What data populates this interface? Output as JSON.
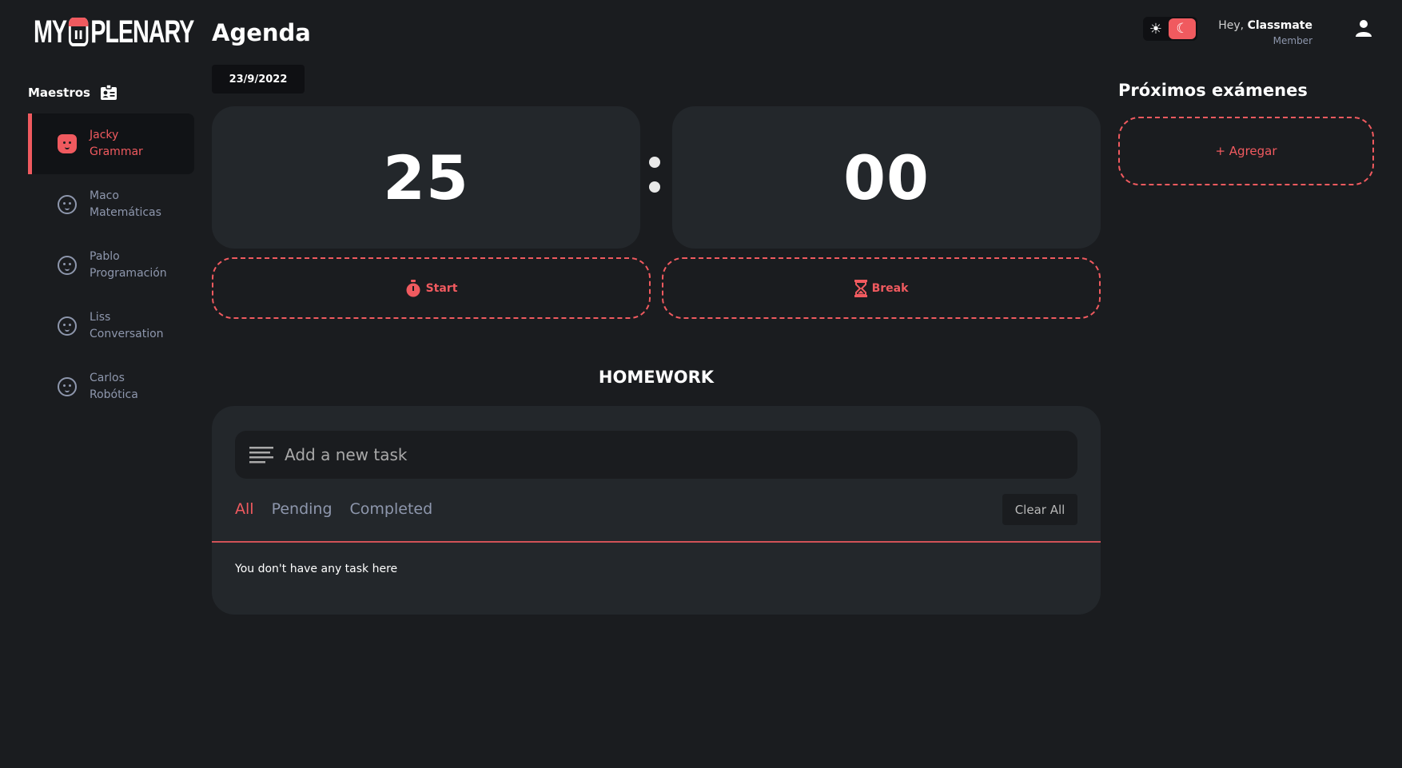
{
  "app": {
    "logo_text_left": "MY",
    "logo_text_right": "PLENARY"
  },
  "sidebar": {
    "title": "Maestros",
    "teachers": [
      {
        "name": "Jacky",
        "subject": "Grammar",
        "active": true
      },
      {
        "name": "Maco",
        "subject": "Matemáticas",
        "active": false
      },
      {
        "name": "Pablo",
        "subject": "Programación",
        "active": false
      },
      {
        "name": "Liss",
        "subject": "Conversation",
        "active": false
      },
      {
        "name": "Carlos",
        "subject": "Robótica",
        "active": false
      }
    ]
  },
  "header": {
    "page_title": "Agenda",
    "date": "23/9/2022",
    "greeting": "Hey,",
    "username": "Classmate",
    "role": "Member",
    "theme": {
      "sun_icon": "sun-icon",
      "moon_icon": "moon-icon",
      "active": "dark"
    }
  },
  "timer": {
    "minutes": "25",
    "seconds": "00",
    "start_label": "Start",
    "break_label": "Break"
  },
  "homework": {
    "title": "HOMEWORK",
    "input_placeholder": "Add a new task",
    "filters": [
      "All",
      "Pending",
      "Completed"
    ],
    "active_filter": "All",
    "clear_label": "Clear All",
    "empty_message": "You don't have any task here"
  },
  "exams": {
    "title": "Próximos exámenes",
    "add_label": "+ Agregar"
  },
  "colors": {
    "accent": "#f05a5f",
    "background": "#1a1c1f",
    "card": "#23272b",
    "muted": "#8e97ad"
  }
}
